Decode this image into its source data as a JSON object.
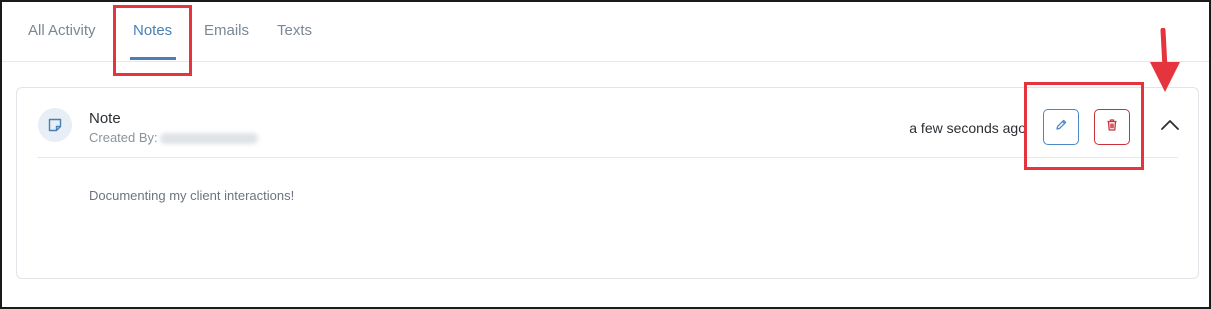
{
  "tabs": [
    {
      "label": "All Activity",
      "active": false
    },
    {
      "label": "Notes",
      "active": true
    },
    {
      "label": "Emails",
      "active": false
    },
    {
      "label": "Texts",
      "active": false
    }
  ],
  "note": {
    "title": "Note",
    "created_by_label": "Created By:",
    "timestamp": "a few seconds ago",
    "body": "Documenting my client interactions!"
  },
  "icons": {
    "avatar": "note-icon",
    "edit": "pencil-icon",
    "delete": "trash-icon",
    "collapse": "chevron-up-icon"
  },
  "colors": {
    "accent": "#4a7fb5",
    "danger": "#c9323b",
    "annotation": "#e5343d"
  }
}
